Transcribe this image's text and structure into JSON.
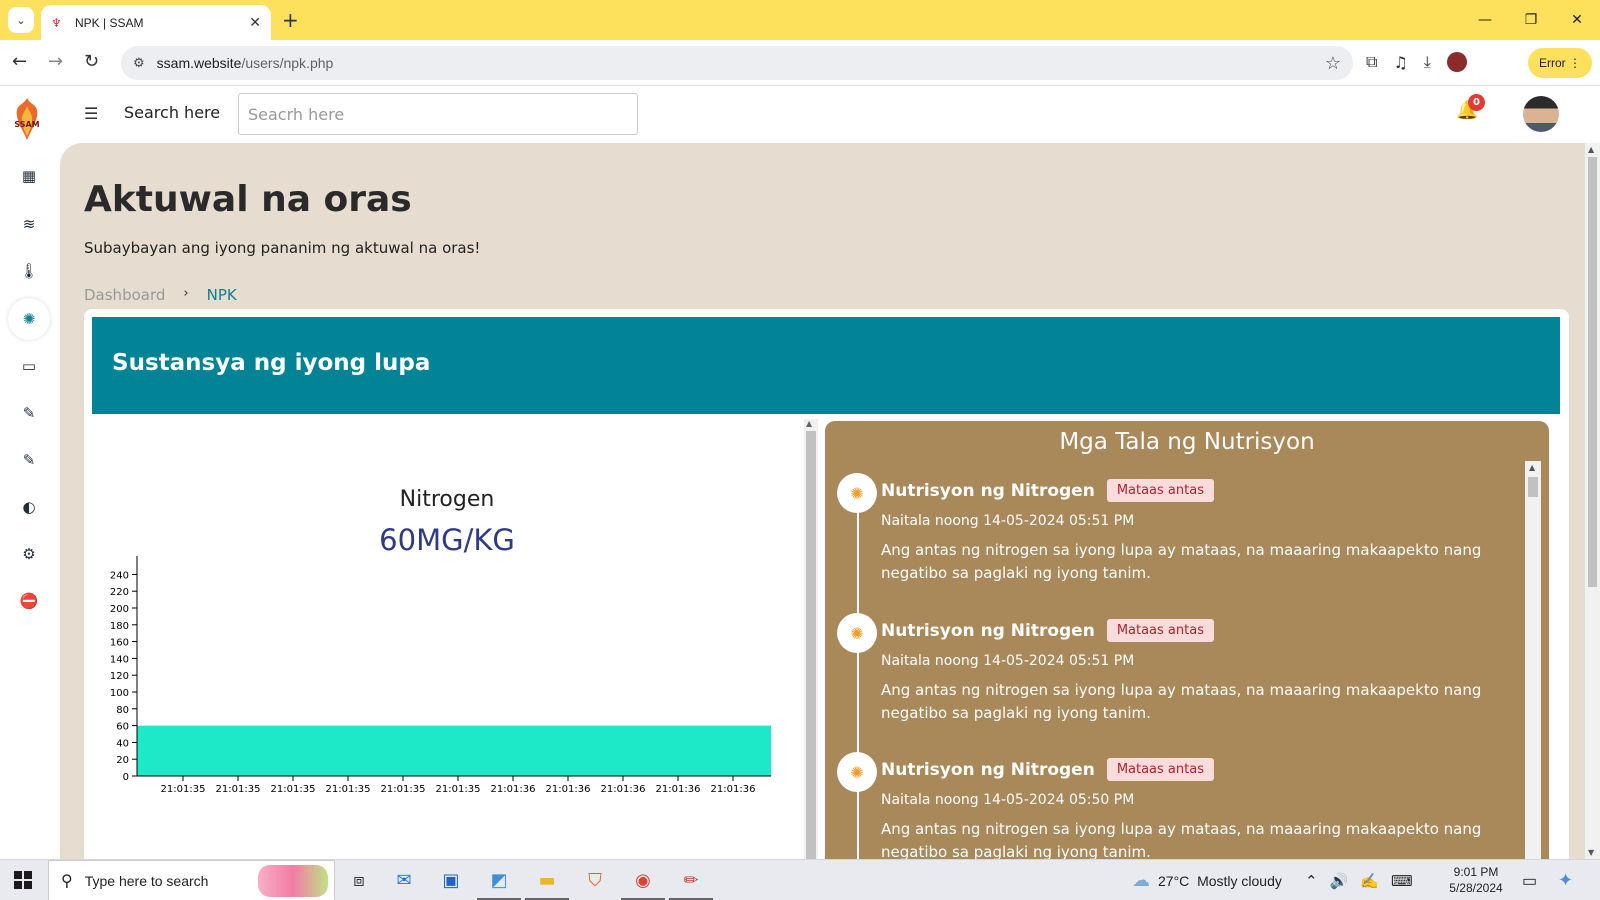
{
  "browser": {
    "tab_title": "NPK | SSAM",
    "url_domain": "ssam.website",
    "url_path": "/users/npk.php",
    "error_label": "Error"
  },
  "app": {
    "logo_text": "SSAM",
    "search_label": "Search here",
    "search_placeholder": "Seacrh here",
    "notification_count": "0"
  },
  "page": {
    "title": "Aktuwal na oras",
    "subtitle": "Subaybayan ang iyong pananim ng aktuwal na oras!",
    "breadcrumb": {
      "home": "Dashboard",
      "separator": "›",
      "current": "NPK"
    },
    "card_title": "Sustansya ng iyong lupa"
  },
  "chart": {
    "title": "Nitrogen",
    "value_label": "60MG/KG",
    "fill_color": "#1de9c9"
  },
  "chart_data": {
    "type": "area",
    "title": "Nitrogen",
    "x": [
      "21:01:35",
      "21:01:35",
      "21:01:35",
      "21:01:35",
      "21:01:35",
      "21:01:35",
      "21:01:36",
      "21:01:36",
      "21:01:36",
      "21:01:36",
      "21:01:36"
    ],
    "values": [
      60,
      60,
      60,
      60,
      60,
      60,
      60,
      60,
      60,
      60,
      60
    ],
    "yticks": [
      0,
      20,
      40,
      60,
      80,
      100,
      120,
      140,
      160,
      180,
      200,
      220,
      240
    ],
    "ylim": [
      0,
      250
    ],
    "xlabel": "",
    "ylabel": "",
    "grid": false
  },
  "notes": {
    "title": "Mga Tala ng Nutrisyon",
    "items": [
      {
        "name": "Nutrisyon ng Nitrogen",
        "badge": "Mataas antas",
        "date": "Naitala noong 14-05-2024 05:51 PM",
        "body": "Ang antas ng nitrogen sa iyong lupa ay mataas, na maaaring makaapekto nang negatibo sa paglaki ng iyong tanim."
      },
      {
        "name": "Nutrisyon ng Nitrogen",
        "badge": "Mataas antas",
        "date": "Naitala noong 14-05-2024 05:51 PM",
        "body": "Ang antas ng nitrogen sa iyong lupa ay mataas, na maaaring makaapekto nang negatibo sa paglaki ng iyong tanim."
      },
      {
        "name": "Nutrisyon ng Nitrogen",
        "badge": "Mataas antas",
        "date": "Naitala noong 14-05-2024 05:50 PM",
        "body": "Ang antas ng nitrogen sa iyong lupa ay mataas, na maaaring makaapekto nang negatibo sa paglaki ng iyong tanim."
      }
    ]
  },
  "taskbar": {
    "search_placeholder": "Type here to search",
    "weather_temp": "27°C",
    "weather_desc": "Mostly cloudy",
    "time": "9:01 PM",
    "date": "5/28/2024"
  }
}
